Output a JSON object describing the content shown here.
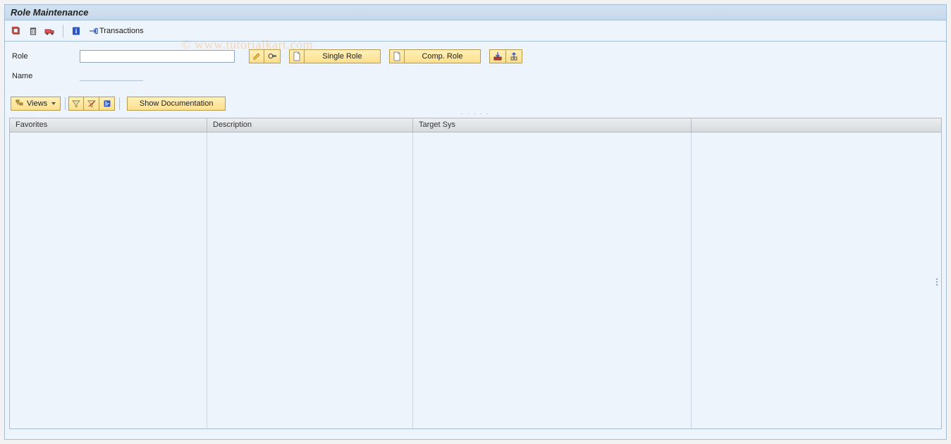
{
  "title": "Role Maintenance",
  "toolbar": {
    "transactions_label": "Transactions"
  },
  "form": {
    "role_label": "Role",
    "role_value": "",
    "name_label": "Name",
    "name_value": "",
    "single_role_label": "Single Role",
    "comp_role_label": "Comp. Role"
  },
  "toolbar2": {
    "views_label": "Views",
    "show_doc_label": "Show Documentation"
  },
  "table": {
    "headers": {
      "favorites": "Favorites",
      "description": "Description",
      "target_sys": "Target Sys"
    }
  },
  "watermark": "© www.tutorialkart.com"
}
